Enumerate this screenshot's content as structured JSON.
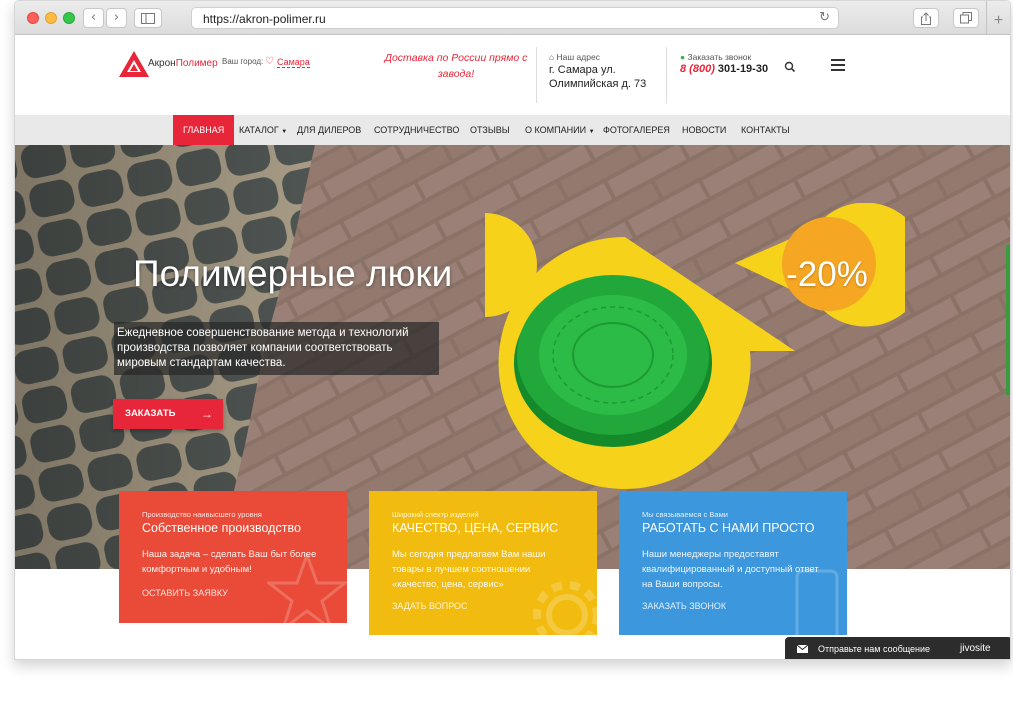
{
  "browser": {
    "url": "https://akron-polimer.ru",
    "back_icon": "chevron-left",
    "forward_icon": "chevron-right",
    "sidebar_icon": "sidebar",
    "reload_icon": "reload",
    "share_icon": "share",
    "tabs_icon": "tabs",
    "new_tab_icon": "plus"
  },
  "header": {
    "logo_part1": "Акрон",
    "logo_part2": "Полимер",
    "city_label": "Ваш город:",
    "city": "Самара",
    "delivery": "Доставка по России прямо с завода!",
    "address_label": "Наш адрес",
    "address": "г. Самара ул. Олимпийская д. 73",
    "call_label": "Заказать звонок",
    "phone_code": "8 (800)",
    "phone_number": "301-19-30"
  },
  "nav": {
    "items": [
      "ГЛАВНАЯ",
      "КАТАЛОГ",
      "ДЛЯ ДИЛЕРОВ",
      "СОТРУДНИЧЕСТВО",
      "ОТЗЫВЫ",
      "О КОМПАНИИ",
      "ФОТОГАЛЕРЕЯ",
      "НОВОСТИ",
      "КОНТАКТЫ"
    ],
    "active": "ГЛАВНАЯ"
  },
  "hero": {
    "title": "Полимерные люки",
    "description": "Ежедневное совершенствование метода и технологий производства позволяет компании соответствовать мировым стандартам качества.",
    "button": "ЗАКАЗАТЬ",
    "discount": "-20%"
  },
  "cards": [
    {
      "subtitle": "Производство наивысшего уровня",
      "title": "Собственное производство",
      "text": "Наша задача – сделать Ваш быт более комфортным и удобным!",
      "link": "ОСТАВИТЬ ЗАЯВКУ",
      "color": "#e94b38"
    },
    {
      "subtitle": "Широкий спектр изделий",
      "title": "КАЧЕСТВО, ЦЕНА, СЕРВИС",
      "text": "Мы сегодня предлагаем Вам наши товары в лучшем соотношении «качество, цена, сервис»",
      "link": "ЗАДАТЬ ВОПРОС",
      "color": "#f2bb0f"
    },
    {
      "subtitle": "Мы связываемся с Вами",
      "title": "РАБОТАТЬ С НАМИ ПРОСТО",
      "text": "Наши менеджеры предоставят квалифицированный и доступный ответ на Ваши вопросы.",
      "link": "ЗАКАЗАТЬ ЗВОНОК",
      "color": "#3c97dd"
    }
  ],
  "chat": {
    "text": "Отправьте нам сообщение",
    "brand": "jivosite"
  },
  "colors": {
    "accent": "#e8263a",
    "nav_bg": "#e9e9e9",
    "discount_yellow": "#f6d21b",
    "discount_orange": "#f5a623",
    "hatch_green": "#22a83a"
  }
}
